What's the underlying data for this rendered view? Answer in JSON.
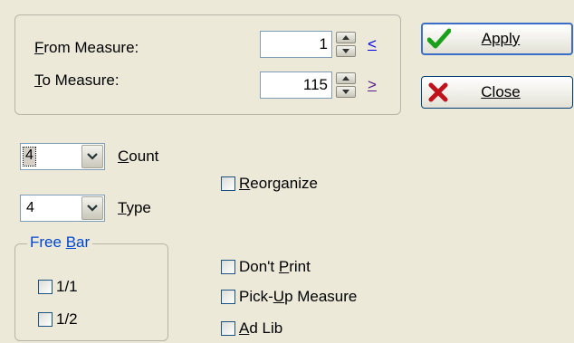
{
  "measures": {
    "from_label": "From Measure:",
    "from_value": "1",
    "from_link": "<",
    "to_label": "To Measure:",
    "to_value": "115",
    "to_link": ">"
  },
  "buttons": {
    "apply_label": "Apply",
    "close_label": "Close"
  },
  "count": {
    "value": "4",
    "label": "Count"
  },
  "type": {
    "value": "4",
    "label": "Type"
  },
  "options": {
    "reorganize": {
      "label": "Reorganize",
      "checked": false
    },
    "dont_print": {
      "label": "Don't Print",
      "checked": false
    },
    "pickup_measure": {
      "label": "Pick-Up Measure",
      "checked": false
    },
    "ad_lib": {
      "label": "Ad Lib",
      "checked": false
    }
  },
  "free_bar": {
    "title": "Free Bar",
    "items": [
      {
        "label": "1/1",
        "checked": false
      },
      {
        "label": "1/2",
        "checked": false
      }
    ]
  },
  "colors": {
    "dialog_bg": "#ece9d8",
    "link_blue": "#0000ee",
    "link_visited": "#551a8b",
    "groupbox_title": "#0046d5",
    "apply_icon": "#1aa01a",
    "close_icon": "#c0121b"
  },
  "icons": {
    "apply": "checkmark-icon",
    "close": "x-icon",
    "spinner": "spinner-arrows",
    "dropdown": "chevron-down-icon"
  }
}
